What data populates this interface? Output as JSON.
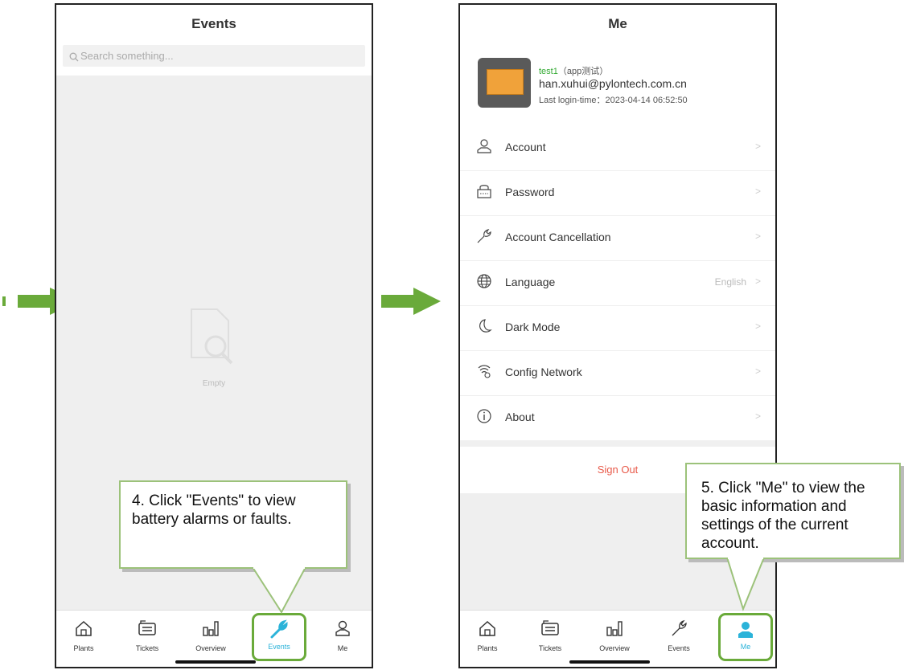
{
  "events_screen": {
    "title": "Events",
    "search_placeholder": "Search something...",
    "empty_text": "Empty"
  },
  "me_screen": {
    "title": "Me",
    "profile": {
      "name": "test1",
      "tag": "（app测试）",
      "email": "han.xuhui@pylontech.com.cn",
      "last_login": "Last login-time：2023-04-14 06:52:50"
    },
    "menu": [
      {
        "label": "Account",
        "icon": "user-icon",
        "value": ""
      },
      {
        "label": "Password",
        "icon": "lock-icon",
        "value": ""
      },
      {
        "label": "Account Cancellation",
        "icon": "wrench-icon",
        "value": ""
      },
      {
        "label": "Language",
        "icon": "globe-icon",
        "value": "English"
      },
      {
        "label": "Dark Mode",
        "icon": "moon-icon",
        "value": ""
      },
      {
        "label": "Config Network",
        "icon": "network-icon",
        "value": ""
      },
      {
        "label": "About",
        "icon": "info-icon",
        "value": ""
      }
    ],
    "sign_out": "Sign Out"
  },
  "tabbar": {
    "plants": "Plants",
    "tickets": "Tickets",
    "overview": "Overview",
    "events": "Events",
    "me": "Me"
  },
  "callouts": {
    "step4": "4. Click \"Events\" to view battery alarms or faults.",
    "step5": "5. Click \"Me\" to view the basic information and settings of the current account."
  },
  "colors": {
    "arrow_green": "#6aaa3a",
    "active_tab": "#2bb3d9",
    "callout_border": "#9cc27a",
    "sign_out_red": "#e85a4a"
  }
}
